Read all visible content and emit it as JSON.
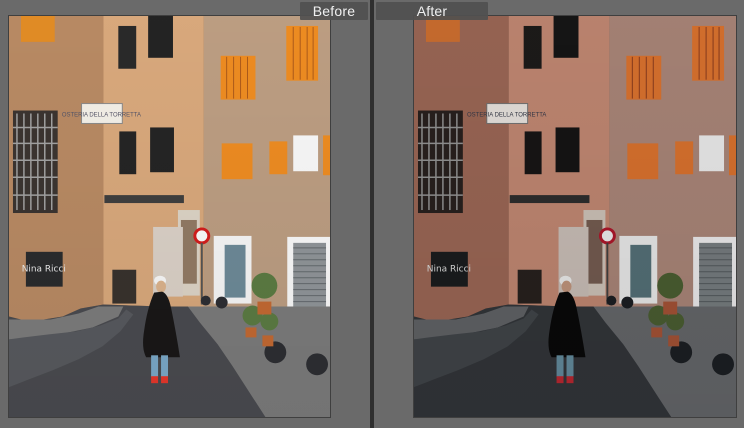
{
  "comparison": {
    "before_label": "Before",
    "after_label": "After"
  },
  "scene": {
    "signage_text": "OSTERIA DELLA TORRETTA",
    "wall_graffiti": "Nina Ricci"
  },
  "colors": {
    "background": "#5c5c5c",
    "panel": "#6a6a6a",
    "divider": "#2f2f2f",
    "badge_bg": "#505050",
    "badge_text": "#f0f0f0",
    "building_left": "#b38a67",
    "building_middle": "#d3a77f",
    "building_right": "#b89d84",
    "shutter_orange": "#e48c2c",
    "street_dark": "#4b4c50",
    "sidewalk": "#7c7c7c",
    "coat_black": "#1b1a1a",
    "pant_blue": "#7da7c4"
  }
}
